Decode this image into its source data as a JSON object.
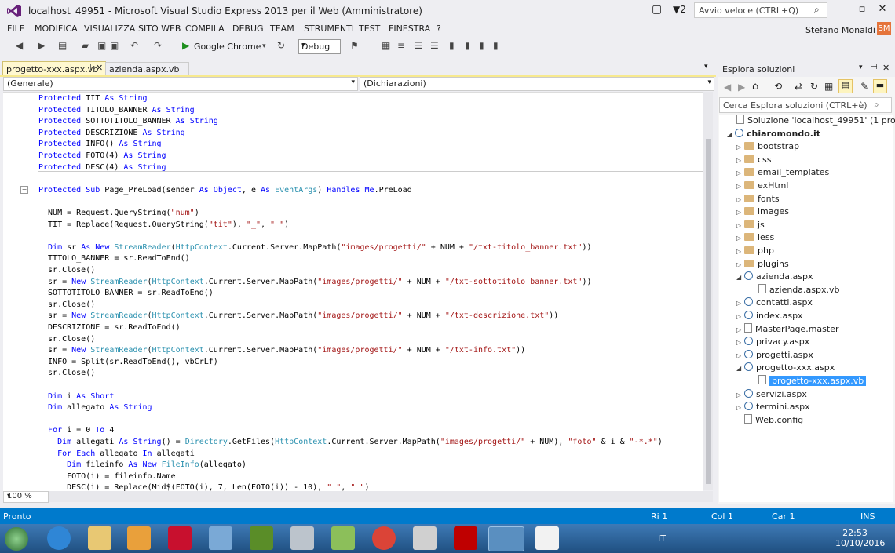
{
  "window": {
    "title": "localhost_49951 - Microsoft Visual Studio Express 2013 per il Web (Amministratore)",
    "notification_count": "2",
    "quick_launch_placeholder": "Avvio veloce (CTRL+Q)",
    "user_name": "Stefano Monaldi",
    "user_initials": "SM"
  },
  "menu": [
    "FILE",
    "MODIFICA",
    "VISUALIZZA",
    "SITO WEB",
    "COMPILA",
    "DEBUG",
    "TEAM",
    "STRUMENTI",
    "TEST",
    "FINESTRA",
    "?"
  ],
  "toolbar": {
    "browser_label": "Google Chrome",
    "config_label": "Debug"
  },
  "tabs": {
    "active": "progetto-xxx.aspx.vb",
    "inactive": "azienda.aspx.vb"
  },
  "navbar": {
    "left": "(Generale)",
    "right": "(Dichiarazioni)"
  },
  "zoom": "100 %",
  "code_lines": [
    "    Protected TIT As String",
    "    Protected TITOLO_BANNER As String",
    "    Protected SOTTOTITOLO_BANNER As String",
    "    Protected DESCRIZIONE As String",
    "    Protected INFO() As String",
    "    Protected FOTO(4) As String",
    "    Protected DESC(4) As String",
    "",
    "    Protected Sub Page_PreLoad(sender As Object, e As EventArgs) Handles Me.PreLoad",
    "",
    "      NUM = Request.QueryString(\"num\")",
    "      TIT = Replace(Request.QueryString(\"tit\"), \"_\", \" \")",
    "",
    "      Dim sr As New StreamReader(HttpContext.Current.Server.MapPath(\"images/progetti/\" + NUM + \"/txt-titolo_banner.txt\"))",
    "      TITOLO_BANNER = sr.ReadToEnd()",
    "      sr.Close()",
    "      sr = New StreamReader(HttpContext.Current.Server.MapPath(\"images/progetti/\" + NUM + \"/txt-sottotitolo_banner.txt\"))",
    "      SOTTOTITOLO_BANNER = sr.ReadToEnd()",
    "      sr.Close()",
    "      sr = New StreamReader(HttpContext.Current.Server.MapPath(\"images/progetti/\" + NUM + \"/txt-descrizione.txt\"))",
    "      DESCRIZIONE = sr.ReadToEnd()",
    "      sr.Close()",
    "      sr = New StreamReader(HttpContext.Current.Server.MapPath(\"images/progetti/\" + NUM + \"/txt-info.txt\"))",
    "      INFO = Split(sr.ReadToEnd(), vbCrLf)",
    "      sr.Close()",
    "",
    "      Dim i As Short",
    "      Dim allegato As String",
    "",
    "      For i = 0 To 4",
    "        Dim allegati As String() = Directory.GetFiles(HttpContext.Current.Server.MapPath(\"images/progetti/\" + NUM), \"foto\" & i & \"-*.*\")",
    "        For Each allegato In allegati",
    "          Dim fileinfo As New FileInfo(allegato)",
    "          FOTO(i) = fileinfo.Name",
    "          DESC(i) = Replace(Mid$(FOTO(i), 7, Len(FOTO(i)) - 10), \"_\", \" \")"
  ],
  "solution_explorer": {
    "title": "Esplora soluzioni",
    "search_placeholder": "Cerca Esplora soluzioni (CTRL+è)",
    "items": [
      {
        "label": "Soluzione 'localhost_49951'  (1 progetto)",
        "level": 0,
        "type": "solution",
        "exp": ""
      },
      {
        "label": "chiaromondo.it",
        "level": 0,
        "type": "web",
        "exp": "◢",
        "bold": true
      },
      {
        "label": "bootstrap",
        "level": 1,
        "type": "folder",
        "exp": "▷"
      },
      {
        "label": "css",
        "level": 1,
        "type": "folder",
        "exp": "▷"
      },
      {
        "label": "email_templates",
        "level": 1,
        "type": "folder",
        "exp": "▷"
      },
      {
        "label": "exHtml",
        "level": 1,
        "type": "folder",
        "exp": "▷"
      },
      {
        "label": "fonts",
        "level": 1,
        "type": "folder",
        "exp": "▷"
      },
      {
        "label": "images",
        "level": 1,
        "type": "folder",
        "exp": "▷"
      },
      {
        "label": "js",
        "level": 1,
        "type": "folder",
        "exp": "▷"
      },
      {
        "label": "less",
        "level": 1,
        "type": "folder",
        "exp": "▷"
      },
      {
        "label": "php",
        "level": 1,
        "type": "folder",
        "exp": "▷"
      },
      {
        "label": "plugins",
        "level": 1,
        "type": "folder",
        "exp": "▷"
      },
      {
        "label": "azienda.aspx",
        "level": 1,
        "type": "web",
        "exp": "◢"
      },
      {
        "label": "azienda.aspx.vb",
        "level": 2,
        "type": "file",
        "exp": ""
      },
      {
        "label": "contatti.aspx",
        "level": 1,
        "type": "web",
        "exp": "▷"
      },
      {
        "label": "index.aspx",
        "level": 1,
        "type": "web",
        "exp": "▷"
      },
      {
        "label": "MasterPage.master",
        "level": 1,
        "type": "file",
        "exp": "▷"
      },
      {
        "label": "privacy.aspx",
        "level": 1,
        "type": "web",
        "exp": "▷"
      },
      {
        "label": "progetti.aspx",
        "level": 1,
        "type": "web",
        "exp": "▷"
      },
      {
        "label": "progetto-xxx.aspx",
        "level": 1,
        "type": "web",
        "exp": "◢"
      },
      {
        "label": "progetto-xxx.aspx.vb",
        "level": 2,
        "type": "file",
        "exp": "",
        "selected": true
      },
      {
        "label": "servizi.aspx",
        "level": 1,
        "type": "web",
        "exp": "▷"
      },
      {
        "label": "termini.aspx",
        "level": 1,
        "type": "web",
        "exp": "▷"
      },
      {
        "label": "Web.config",
        "level": 1,
        "type": "file",
        "exp": ""
      }
    ]
  },
  "status": {
    "message": "Pronto",
    "row": "Ri 1",
    "col": "Col 1",
    "car": "Car 1",
    "mode": "INS"
  },
  "taskbar": {
    "lang": "IT",
    "time": "22:53",
    "date": "10/10/2016"
  },
  "colors": {
    "accent": "#007acc",
    "tab_active": "#fff8d0",
    "selection": "#3399ff"
  }
}
